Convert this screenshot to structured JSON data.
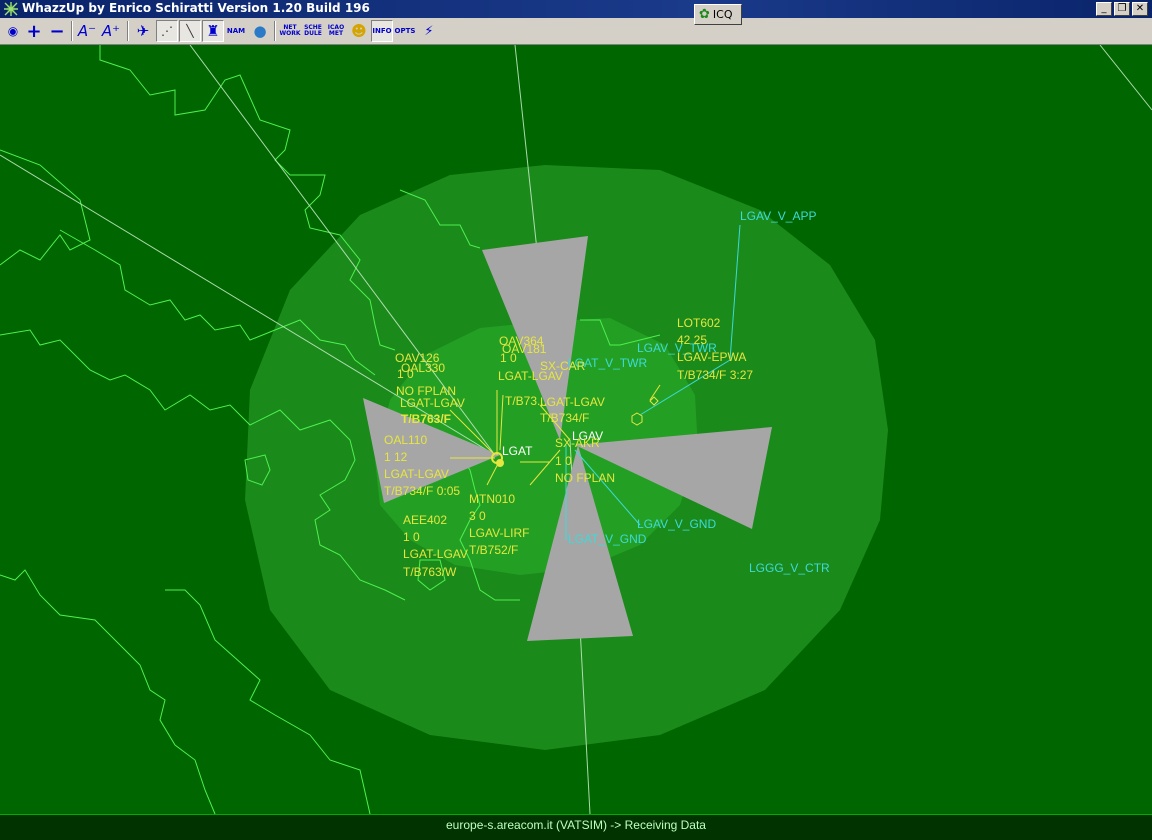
{
  "window": {
    "title": "WhazzUp by Enrico Schiratti Version 1.20 Build 196",
    "icq_label": "ICQ",
    "minimize": "_",
    "maximize": "❐",
    "close": "✕"
  },
  "toolbar": {
    "buttons": [
      {
        "name": "globe-icon",
        "glyph": "◉"
      },
      {
        "name": "zoom-in-button",
        "glyph": "+"
      },
      {
        "name": "zoom-out-button",
        "glyph": "−"
      },
      {
        "name": "font-smaller-button",
        "glyph": "A⁻"
      },
      {
        "name": "font-larger-button",
        "glyph": "A⁺"
      },
      {
        "name": "aircraft-icon",
        "glyph": "✈"
      },
      {
        "name": "dotted-route-icon",
        "glyph": "⋰"
      },
      {
        "name": "track-line-icon",
        "glyph": "╲"
      },
      {
        "name": "tower-icon",
        "glyph": "♜"
      },
      {
        "name": "nam-button",
        "glyph": "NAM"
      },
      {
        "name": "earth-icon",
        "glyph": "●"
      },
      {
        "name": "network-button",
        "glyph": "NET\nWORK"
      },
      {
        "name": "schedule-button",
        "glyph": "SCHE\nDULE"
      },
      {
        "name": "icao-met-button",
        "glyph": "ICAO\nMET"
      },
      {
        "name": "smiley-icon",
        "glyph": "☻"
      },
      {
        "name": "info-button",
        "glyph": "INFO"
      },
      {
        "name": "options-button",
        "glyph": "OPTS"
      },
      {
        "name": "scope-icon",
        "glyph": "⚡"
      }
    ]
  },
  "colors": {
    "background": "#006600",
    "outer_ring": "#1a8a1a",
    "inner_ring": "#23a023",
    "coastline": "#4ef04e",
    "aircraft_label": "#e6e640",
    "controller_label": "#3fd9d9",
    "runway_sector": "#a6a6a6"
  },
  "map": {
    "airport_labels": [
      {
        "id": "lgat",
        "text": "LGAT"
      },
      {
        "id": "lgav",
        "text": "LGAV"
      }
    ],
    "controllers": [
      {
        "id": "app",
        "text": "LGAV_V_APP"
      },
      {
        "id": "twr",
        "text": "LGAV_V_TWR"
      },
      {
        "id": "lgat-twr",
        "text": "LGAT_V_TWR"
      },
      {
        "id": "gnd",
        "text": "LGAV_V_GND"
      },
      {
        "id": "lgat-gnd",
        "text": "LGAT_V_GND"
      },
      {
        "id": "ctr",
        "text": "LGGG_V_CTR"
      }
    ],
    "aircraft": [
      {
        "id": "oav126",
        "lines": [
          "OAV126",
          "1 0",
          "NO FPLAN"
        ]
      },
      {
        "id": "oal330",
        "lines": [
          "OAL330",
          "LGAT-LGAV",
          "T/B763/F"
        ]
      },
      {
        "id": "oav364",
        "lines": [
          "OAV364",
          "1 0"
        ]
      },
      {
        "id": "oav181",
        "lines": [
          "OAV181",
          "LGAT-LGAV",
          "T/B73..."
        ]
      },
      {
        "id": "sxcar",
        "lines": [
          "SX-CAR",
          "LGAT-LGAV",
          "T/B734/F"
        ]
      },
      {
        "id": "lot602",
        "lines": [
          "LOT602",
          "42 25",
          "LGAV-EPWA",
          "T/B734/F 3:27"
        ]
      },
      {
        "id": "oal110",
        "lines": [
          "OAL110",
          "1 12",
          "LGAT-LGAV",
          "T/B734/F 0:05"
        ]
      },
      {
        "id": "sxakr",
        "lines": [
          "SX-AKR",
          "1 0",
          "NO FPLAN"
        ]
      },
      {
        "id": "mtn010",
        "lines": [
          "MTN010",
          "3 0",
          "LGAV-LIRF",
          "T/B752/F"
        ]
      },
      {
        "id": "aee402",
        "lines": [
          "AEE402",
          "1 0",
          "LGAT-LGAV",
          "T/B763/W"
        ]
      }
    ]
  },
  "status": {
    "text": "europe-s.areacom.it (VATSIM) -> Receiving Data"
  }
}
